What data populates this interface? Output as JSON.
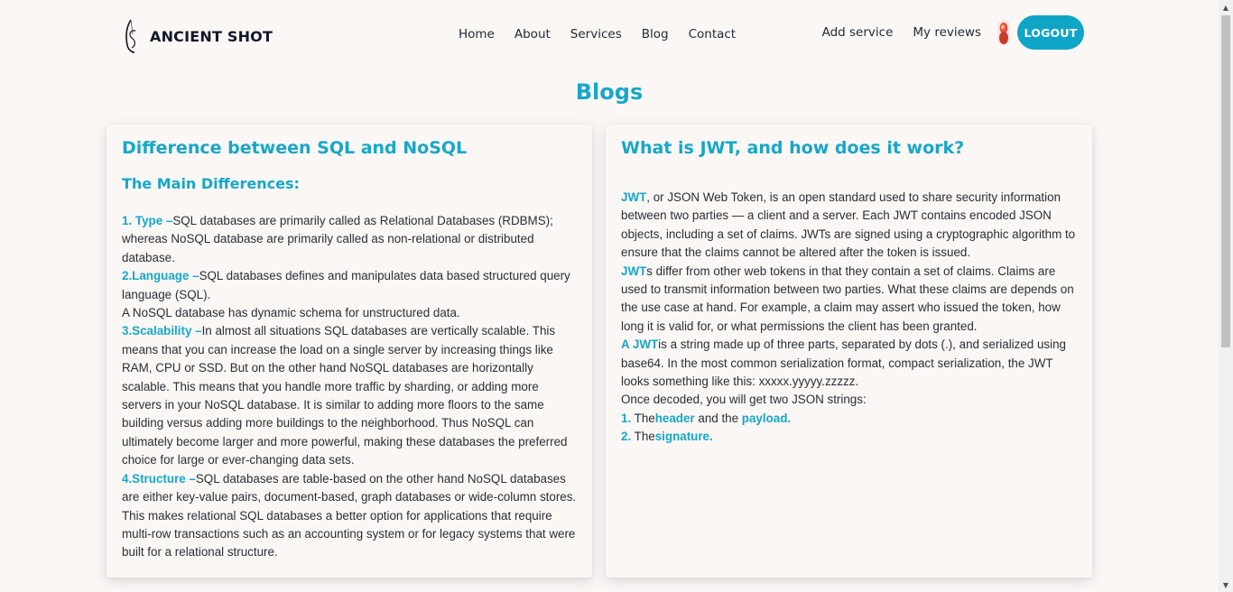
{
  "brand": {
    "name": "ANCIENT SHOT",
    "logo_icon": "feather-s-logo-icon"
  },
  "nav": {
    "links": [
      "Home",
      "About",
      "Services",
      "Blog",
      "Contact"
    ],
    "add_service": "Add service",
    "my_reviews": "My reviews",
    "logout": "LOGOUT"
  },
  "page": {
    "title": "Blogs"
  },
  "colors": {
    "accent": "#17a7c7",
    "button": "#0ea5c6",
    "background": "#faf7f5"
  },
  "left_card": {
    "title": "Difference between SQL and NoSQL",
    "subtitle": "The Main Differences:",
    "type_label": "1. Type –",
    "type_text": "SQL databases are primarily called as Relational Databases (RDBMS); whereas NoSQL database are primarily called as non-relational or distributed database.",
    "language_label": "2.Language –",
    "language_text": "SQL databases defines and manipulates data based structured query language (SQL).",
    "language_text2": "A NoSQL database has dynamic schema for unstructured data.",
    "scalability_label": "3.Scalability –",
    "scalability_text": "In almost all situations SQL databases are vertically scalable. This means that you can increase the load on a single server by increasing things like RAM, CPU or SSD. But on the other hand NoSQL databases are horizontally scalable. This means that you handle more traffic by sharding, or adding more servers in your NoSQL database. It is similar to adding more floors to the same building versus adding more buildings to the neighborhood. Thus NoSQL can ultimately become larger and more powerful, making these databases the preferred choice for large or ever-changing data sets.",
    "structure_label": "4.Structure –",
    "structure_text": "SQL databases are table-based on the other hand NoSQL databases are either key-value pairs, document-based, graph databases or wide-column stores. This makes relational SQL databases a better option for applications that require multi-row transactions such as an accounting system or for legacy systems that were built for a relational structure."
  },
  "right_card": {
    "title": "What is JWT, and how does it work?",
    "p1_label": "JWT",
    "p1_text": ", or JSON Web Token, is an open standard used to share security information between two parties — a client and a server. Each JWT contains encoded JSON objects, including a set of claims. JWTs are signed using a cryptographic algorithm to ensure that the claims cannot be altered after the token is issued.",
    "p2_label": "JWT",
    "p2_text": "s differ from other web tokens in that they contain a set of claims. Claims are used to transmit information between two parties. What these claims are depends on the use case at hand. For example, a claim may assert who issued the token, how long it is valid for, or what permissions the client has been granted.",
    "p3_label": "A JWT",
    "p3_text": "is a string made up of three parts, separated by dots (.), and serialized using base64. In the most common serialization format, compact serialization, the JWT looks something like this: xxxxx.yyyyy.zzzzz.",
    "p4_text": "Once decoded, you will get two JSON strings:",
    "li1_num": "1.",
    "li1_pre": " The",
    "li1_header": "header",
    "li1_mid": " and the ",
    "li1_payload": "payload.",
    "li2_num": "2.",
    "li2_pre": " The",
    "li2_sig": "signature."
  }
}
